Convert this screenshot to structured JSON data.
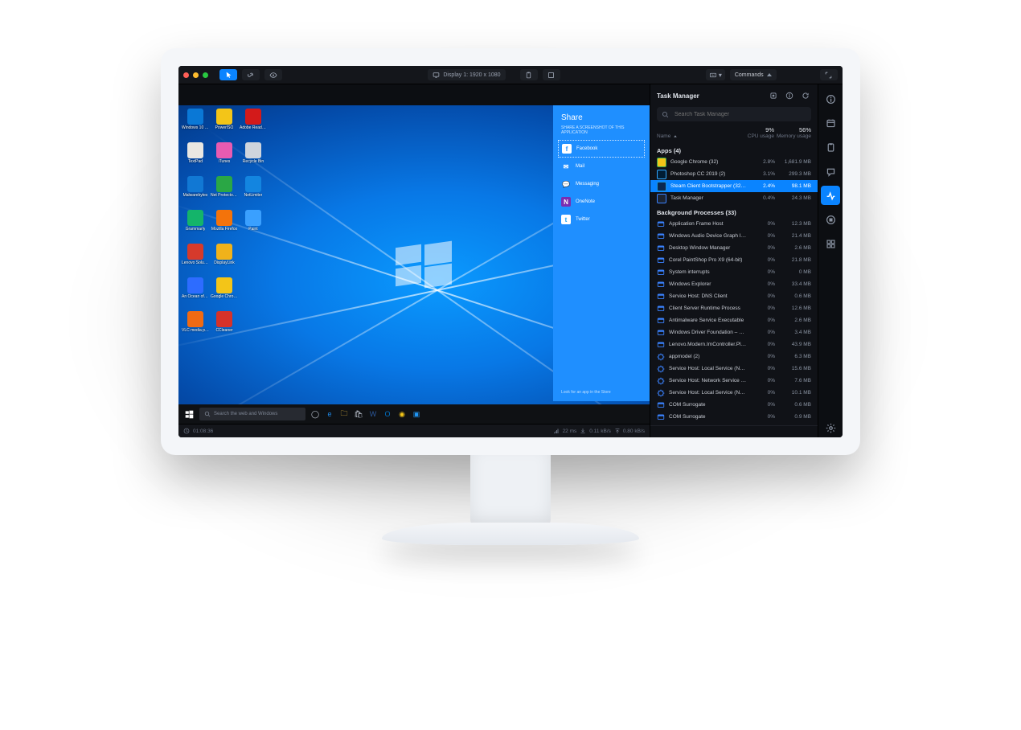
{
  "toolbar": {
    "display": "Display 1: 1920 x 1080",
    "commands": "Commands"
  },
  "desktop_icons": [
    {
      "label": "Windows 10 Upgrade A…",
      "color": "#0a78d6"
    },
    {
      "label": "PowerISO",
      "color": "#f3c518"
    },
    {
      "label": "Adobe Reader XI",
      "color": "#d31a1a"
    },
    {
      "label": "TextPad",
      "color": "#e9e7e2"
    },
    {
      "label": "iTunes",
      "color": "#e85bb1"
    },
    {
      "label": "Recycle Bin",
      "color": "#cfd5dd"
    },
    {
      "label": "Malwarebytes",
      "color": "#1178d4"
    },
    {
      "label": "Net Protector 2017",
      "color": "#2aa745"
    },
    {
      "label": "NetLimiter",
      "color": "#1385e0"
    },
    {
      "label": "Grammarly",
      "color": "#14b46a"
    },
    {
      "label": "Mozilla Firefox",
      "color": "#f3730b"
    },
    {
      "label": "Paint",
      "color": "#3aa0ff"
    },
    {
      "label": "Lenovo Solut…",
      "color": "#d63a2b"
    },
    {
      "label": "DisplayLink",
      "color": "#f0b21a"
    },
    {
      "label": "",
      "color": "transparent"
    },
    {
      "label": "An Ocean of Conundrums",
      "color": "#2d6cff"
    },
    {
      "label": "Google Chrome",
      "color": "#f3c518"
    },
    {
      "label": "",
      "color": "transparent"
    },
    {
      "label": "VLC media player",
      "color": "#f06a13"
    },
    {
      "label": "CCleaner",
      "color": "#d6322a"
    }
  ],
  "share": {
    "title": "Share",
    "subtitle": "SHARE A SCREENSHOT OF THIS APPLICATION",
    "items": [
      {
        "label": "Facebook",
        "icon": "f",
        "bg": "#ffffff",
        "fg": "#1f8fff",
        "selected": true
      },
      {
        "label": "Mail",
        "icon": "✉",
        "bg": "transparent",
        "fg": "#fff"
      },
      {
        "label": "Messaging",
        "icon": "💬",
        "bg": "transparent",
        "fg": "#fff"
      },
      {
        "label": "OneNote",
        "icon": "N",
        "bg": "#7b2db0",
        "fg": "#fff"
      },
      {
        "label": "Twitter",
        "icon": "t",
        "bg": "#ffffff",
        "fg": "#1da1f2"
      }
    ],
    "footer": "Look for an app in the Store"
  },
  "taskbar": {
    "search_placeholder": "Search the web and Windows",
    "icons": [
      {
        "name": "cortana-icon",
        "glyph": "◯",
        "color": "#bfc6d2"
      },
      {
        "name": "edge-icon",
        "glyph": "e",
        "color": "#1e88e5"
      },
      {
        "name": "explorer-icon",
        "glyph": "🗀",
        "color": "#f5c542"
      },
      {
        "name": "store-icon",
        "glyph": "🛍",
        "color": "#bfc6d2"
      },
      {
        "name": "word-icon",
        "glyph": "W",
        "color": "#2b579a"
      },
      {
        "name": "outlook-icon",
        "glyph": "O",
        "color": "#0072c6"
      },
      {
        "name": "chrome-icon",
        "glyph": "◉",
        "color": "#f3c518"
      },
      {
        "name": "remote-icon",
        "glyph": "▣",
        "color": "#2196f3"
      }
    ]
  },
  "tm": {
    "title": "Task Manager",
    "search_placeholder": "Search Task Manager",
    "cols": {
      "name": "Name",
      "cpu": "CPU usage",
      "mem": "Memory usage"
    },
    "summary": {
      "cpu": "9%",
      "mem": "56%"
    },
    "groups": [
      {
        "title": "Apps (4)",
        "rows": [
          {
            "name": "Google Chrome (32)",
            "cpu": "2.8%",
            "mem": "1,681.9 MB",
            "icon": "#f3c518",
            "bd": "#34a853"
          },
          {
            "name": "Photoshop CC 2019 (2)",
            "cpu": "3.1%",
            "mem": "299.3 MB",
            "icon": "#001d34",
            "bd": "#31a8ff"
          },
          {
            "name": "Steam Client Bootstrapper (32 b…",
            "cpu": "2.4%",
            "mem": "98.1 MB",
            "icon": "#0b2850",
            "bd": "#1b93d6",
            "selected": true
          },
          {
            "name": "Task Manager",
            "cpu": "0.4%",
            "mem": "24.3 MB",
            "icon": "#1c2330",
            "bd": "#3a82ff"
          }
        ]
      },
      {
        "title": "Background Processes (33)",
        "rows": [
          {
            "name": "Application Frame Host",
            "cpu": "0%",
            "mem": "12.3 MB"
          },
          {
            "name": "Windows Audio Device Graph Is…",
            "cpu": "0%",
            "mem": "21.4 MB"
          },
          {
            "name": "Desktop Window Manager",
            "cpu": "0%",
            "mem": "2.6 MB"
          },
          {
            "name": "Corel PaintShop Pro X9 (64-bit)",
            "cpu": "0%",
            "mem": "21.8 MB"
          },
          {
            "name": "System interrupts",
            "cpu": "0%",
            "mem": "0 MB"
          },
          {
            "name": "Windows Explorer",
            "cpu": "0%",
            "mem": "33.4 MB"
          },
          {
            "name": "Service Host: DNS Client",
            "cpu": "0%",
            "mem": "0.6 MB"
          },
          {
            "name": "Client Server Runtime Process",
            "cpu": "0%",
            "mem": "12.6 MB"
          },
          {
            "name": "Antimalware Service Executable",
            "cpu": "0%",
            "mem": "2.6 MB"
          },
          {
            "name": "Windows Driver Foundation – U…",
            "cpu": "0%",
            "mem": "3.4 MB"
          },
          {
            "name": "Lenovo.Modern.ImController.Pl…",
            "cpu": "0%",
            "mem": "43.9 MB"
          },
          {
            "name": "appmodel (2)",
            "cpu": "0%",
            "mem": "6.3 MB",
            "svc": true
          },
          {
            "name": "Service Host: Local Service (No …",
            "cpu": "0%",
            "mem": "15.6 MB",
            "svc": true
          },
          {
            "name": "Service Host: Network Service (5)",
            "cpu": "0%",
            "mem": "7.6 MB",
            "svc": true
          },
          {
            "name": "Service Host: Local Service (Net…",
            "cpu": "0%",
            "mem": "10.1 MB",
            "svc": true
          },
          {
            "name": "COM Surrogate",
            "cpu": "0%",
            "mem": "0.6 MB"
          },
          {
            "name": "COM Surrogate",
            "cpu": "0%",
            "mem": "0.9 MB"
          }
        ]
      }
    ]
  },
  "rail": [
    {
      "name": "help-icon",
      "kind": "info"
    },
    {
      "name": "calendar-icon",
      "kind": "calendar"
    },
    {
      "name": "clipboard-icon",
      "kind": "clipboard"
    },
    {
      "name": "chat-icon",
      "kind": "chat"
    },
    {
      "name": "activity-icon",
      "kind": "activity",
      "active": true
    },
    {
      "name": "stop-icon",
      "kind": "stop"
    },
    {
      "name": "grid-icon",
      "kind": "grid"
    },
    {
      "name": "spacer"
    },
    {
      "name": "settings-icon",
      "kind": "gear"
    }
  ],
  "status": {
    "time": "01:08:36",
    "latency": "22 ms",
    "down": "0.11 kB/s",
    "up": "0.80 kB/s"
  }
}
